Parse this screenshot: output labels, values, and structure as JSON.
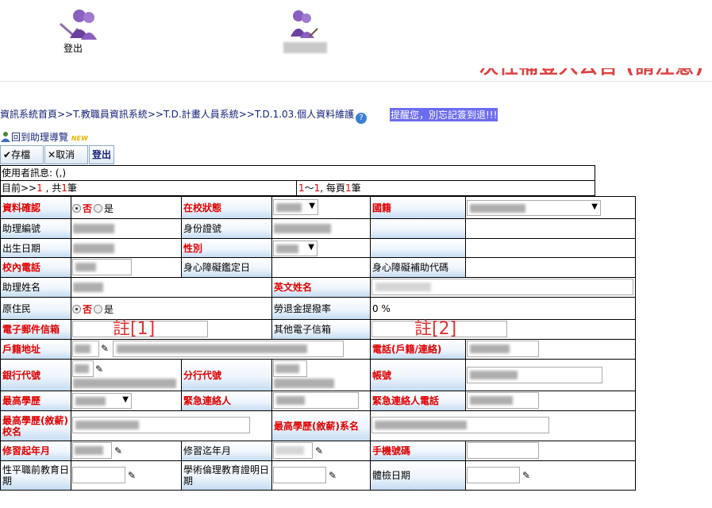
{
  "header": {
    "logout_label": "登出",
    "banner_text": "一次性補登入公告 (請注意)"
  },
  "breadcrumb": "資訊系統首頁>>T.教職員資訊系統>>T.D.計畫人員系統>>T.D.1.03.個人資料維護",
  "help_icon_glyph": "?",
  "reminder": "提醒您，別忘記簽到退!!!",
  "back_link": {
    "label": "回到助理導覽",
    "badge": "NEW"
  },
  "toolbar": {
    "save_label": "存檔",
    "cancel_label": "取消",
    "logout_label": "登出"
  },
  "status": {
    "user_info": "使用者訊息: (,)",
    "position_prefix": "目前>>",
    "position_current": "1",
    "position_mid": " , 共",
    "position_total": "1",
    "position_suffix": "筆",
    "range_from": "1",
    "range_sep": "～",
    "range_to": "1",
    "range_mid": ", 每頁",
    "range_per": "1",
    "range_suffix": "筆"
  },
  "form": {
    "data_confirm": "資料確認",
    "on_campus_status": "在校狀態",
    "nationality": "國籍",
    "assistant_no": "助理編號",
    "id_no": "身份證號",
    "birth_date": "出生日期",
    "gender": "性別",
    "campus_phone": "校內電話",
    "disability_date": "身心障礙鑑定日",
    "disability_code": "身心障礙補助代碼",
    "assistant_name": "助理姓名",
    "english_name": "英文姓名",
    "aboriginal": "原住民",
    "pension_rate": "勞退金提撥率",
    "pension_value": "0 %",
    "email": "電子郵件信箱",
    "other_email": "其他電子信箱",
    "address": "戶籍地址",
    "phone": "電話(戶籍/連絡)",
    "bank_code": "銀行代號",
    "branch_code": "分行代號",
    "account": "帳號",
    "highest_degree": "最高學歷",
    "emergency_contact": "緊急連絡人",
    "emergency_phone": "緊急連絡人電話",
    "degree_school": "最高學歷(敘薪)校名",
    "degree_dept": "最高學歷(敘薪)系名",
    "study_start": "修習起年月",
    "study_end": "修習迄年月",
    "mobile": "手機號碼",
    "gender_edu_date": "性平職前教育日期",
    "ethics_edu_date": "學術倫理教育證明日期",
    "health_check_date": "體檢日期",
    "radio_no": "否",
    "radio_yes": "是",
    "note1": "註[1]",
    "note2": "註[2]"
  }
}
